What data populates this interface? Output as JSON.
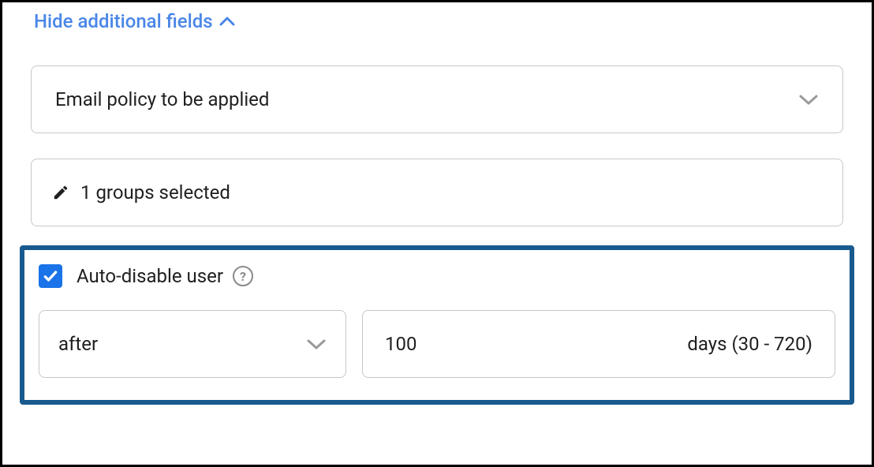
{
  "toggle": {
    "label": "Hide additional fields"
  },
  "emailPolicy": {
    "placeholder": "Email policy to be applied"
  },
  "groups": {
    "label": "1 groups selected"
  },
  "autoDisable": {
    "checked": true,
    "label": "Auto-disable user",
    "timing": {
      "selected": "after"
    },
    "value": "100",
    "unit": "days (30 - 720)"
  }
}
